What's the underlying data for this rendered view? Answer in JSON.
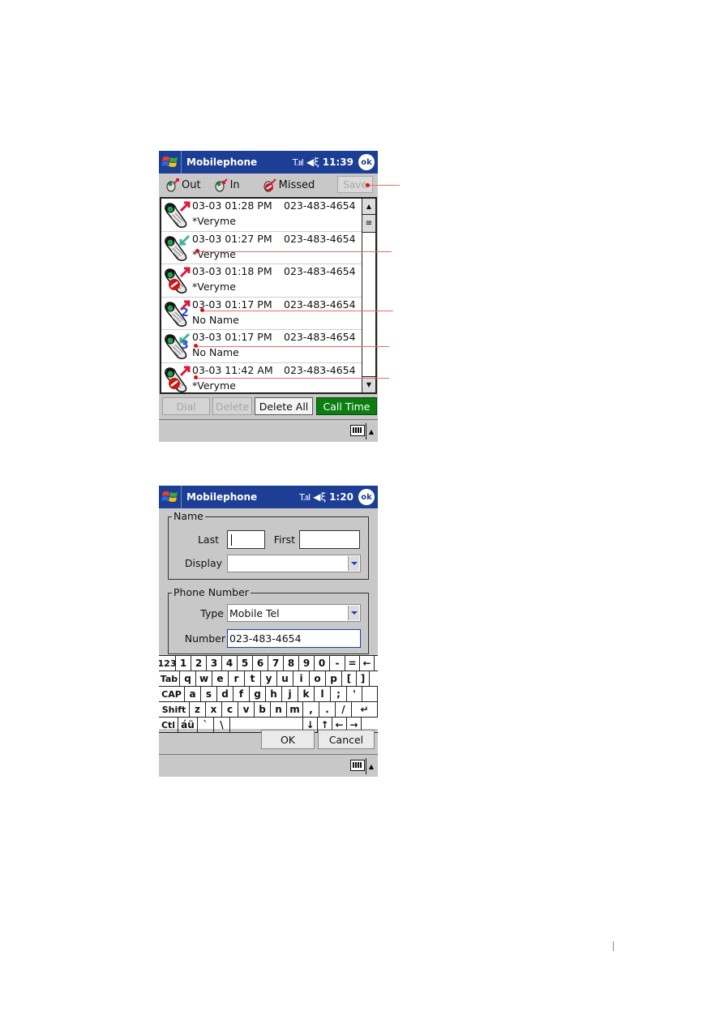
{
  "screen1": {
    "titlebar": {
      "app_title": "Mobilephone",
      "signal_icon": "T.ııl",
      "speaker_icon": "◀ξ",
      "time": "11:39",
      "ok_label": "ok"
    },
    "tabs": [
      {
        "label": "Out",
        "icon": "outgoing-call-icon"
      },
      {
        "label": "In",
        "icon": "incoming-call-icon"
      },
      {
        "label": "Missed",
        "icon": "missed-call-icon"
      }
    ],
    "save_label": "Save",
    "calls": [
      {
        "type": "out",
        "datetime": "03-03 01:28 PM",
        "number": "023-483-4654",
        "name": "*Veryme",
        "badge": ""
      },
      {
        "type": "in",
        "datetime": "03-03 01:27 PM",
        "number": "023-483-4654",
        "name": "*Veryme",
        "badge": ""
      },
      {
        "type": "missed",
        "datetime": "03-03 01:18 PM",
        "number": "023-483-4654",
        "name": "*Veryme",
        "badge": ""
      },
      {
        "type": "out",
        "datetime": "03-03 01:17 PM",
        "number": "023-483-4654",
        "name": "No Name",
        "badge": "2"
      },
      {
        "type": "in",
        "datetime": "03-03 01:17 PM",
        "number": "023-483-4654",
        "name": "No Name",
        "badge": "3"
      },
      {
        "type": "missed",
        "datetime": "03-03 11:42 AM",
        "number": "023-483-4654",
        "name": "*Veryme",
        "badge": ""
      }
    ],
    "buttons": {
      "dial": "Dial",
      "delete": "Delete",
      "delete_all": "Delete All",
      "call_time": "Call Time"
    },
    "colors": {
      "call_time_bg": "#0b7d11",
      "titlebar_bg": "#1c3e95"
    }
  },
  "screen2": {
    "titlebar": {
      "app_title": "Mobilephone",
      "signal_icon": "T.ııl",
      "speaker_icon": "◀ξ",
      "time": "1:20",
      "ok_label": "ok"
    },
    "name_group": {
      "legend": "Name",
      "last_label": "Last",
      "last_value": "",
      "first_label": "First",
      "first_value": "",
      "display_label": "Display",
      "display_value": ""
    },
    "phone_group": {
      "legend": "Phone Number",
      "type_label": "Type",
      "type_value": "Mobile Tel",
      "number_label": "Number",
      "number_value": "023-483-4654"
    },
    "keyboard": {
      "rows": [
        [
          "123",
          "1",
          "2",
          "3",
          "4",
          "5",
          "6",
          "7",
          "8",
          "9",
          "0",
          "-",
          "=",
          "←"
        ],
        [
          "Tab",
          "q",
          "w",
          "e",
          "r",
          "t",
          "y",
          "u",
          "i",
          "o",
          "p",
          "[",
          "]"
        ],
        [
          "CAP",
          "a",
          "s",
          "d",
          "f",
          "g",
          "h",
          "j",
          "k",
          "l",
          ";",
          "'",
          ""
        ],
        [
          "Shift",
          "z",
          "x",
          "c",
          "v",
          "b",
          "n",
          "m",
          ",",
          ".",
          "/",
          "↵"
        ],
        [
          "Ctl",
          "áü",
          "`",
          "\\",
          "",
          "↓",
          "↑",
          "←",
          "→"
        ]
      ]
    },
    "buttons": {
      "ok": "OK",
      "cancel": "Cancel"
    }
  }
}
